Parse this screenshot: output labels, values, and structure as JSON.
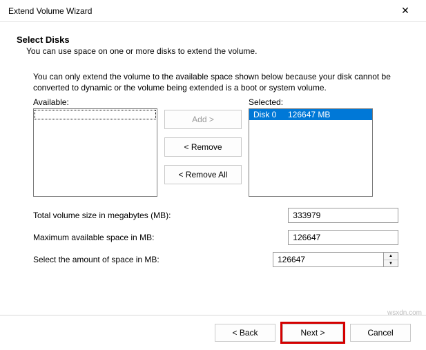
{
  "window": {
    "title": "Extend Volume Wizard"
  },
  "header": {
    "title": "Select Disks",
    "subtitle": "You can use space on one or more disks to extend the volume."
  },
  "info": "You can only extend the volume to the available space shown below because your disk cannot be converted to dynamic or the volume being extended is a boot or system volume.",
  "labels": {
    "available": "Available:",
    "selected": "Selected:",
    "add": "Add >",
    "remove": "< Remove",
    "removeAll": "< Remove All",
    "total": "Total volume size in megabytes (MB):",
    "max": "Maximum available space in MB:",
    "select": "Select the amount of space in MB:"
  },
  "selected_item": "Disk 0     126647 MB",
  "values": {
    "total": "333979",
    "max": "126647",
    "select": "126647"
  },
  "footer": {
    "back": "< Back",
    "next": "Next >",
    "cancel": "Cancel"
  },
  "watermark": "wsxdn.com"
}
